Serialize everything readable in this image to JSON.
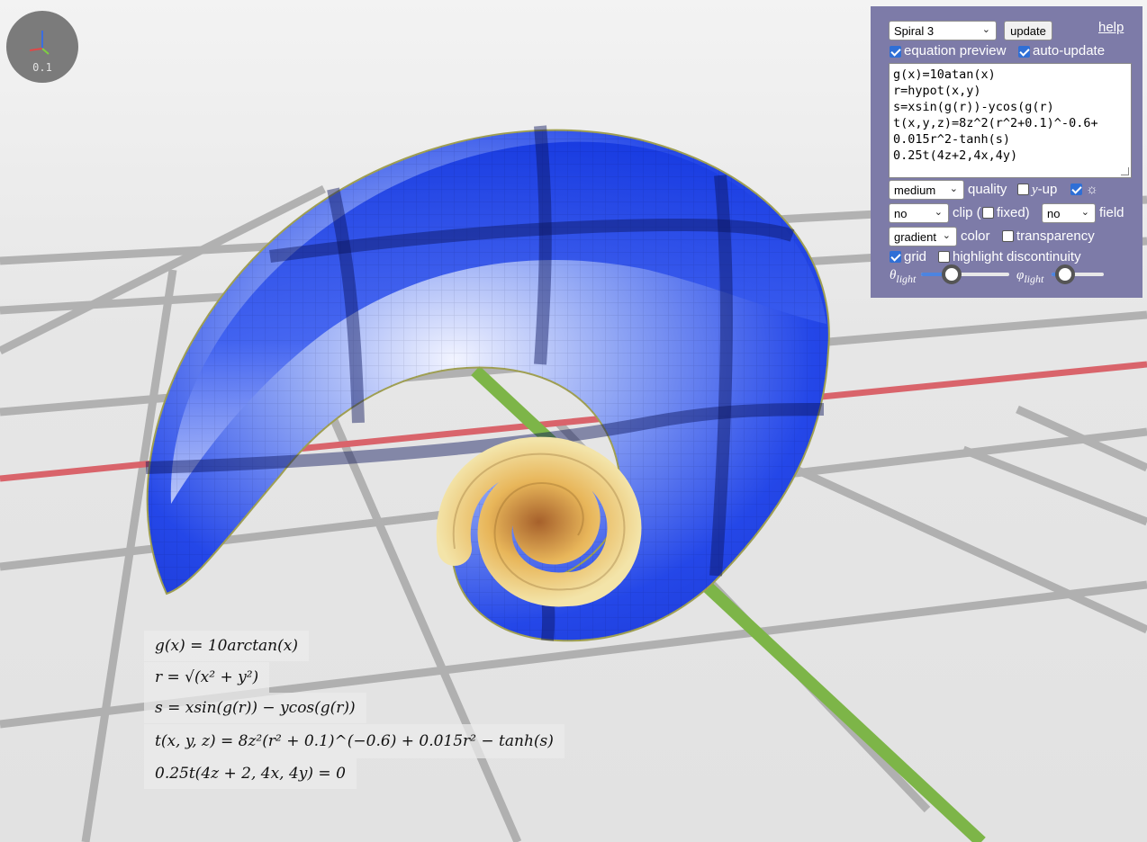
{
  "gizmo": {
    "scale_label": "0.1"
  },
  "panel": {
    "preset": {
      "selected": "Spiral 3"
    },
    "update_label": "update",
    "help_label": "help",
    "equation_preview": {
      "label": "equation preview",
      "checked": true
    },
    "auto_update": {
      "label": "auto-update",
      "checked": true
    },
    "editor_lines": [
      "g(x)=10atan(x)",
      "r=hypot(x,y)",
      "s=xsin(g(r))-ycos(g(r)",
      "t(x,y,z)=8z^2(r^2+0.1)^-0.6+",
      "0.015r^2-tanh(s)",
      "0.25t(4z+2,4x,4y)"
    ],
    "quality": {
      "selected": "medium",
      "label": "quality"
    },
    "y_up": {
      "label_var": "y",
      "label_rest": "-up",
      "checked": false
    },
    "light_toggle": {
      "symbol": "☼",
      "checked": true
    },
    "clip": {
      "selected": "no",
      "label": "clip (",
      "fixed_label": "fixed)",
      "fixed_checked": false
    },
    "field": {
      "selected": "no",
      "label": "field"
    },
    "color": {
      "selected": "gradient",
      "label": "color"
    },
    "transparency": {
      "label": "transparency",
      "checked": false
    },
    "grid": {
      "label": "grid",
      "checked": true
    },
    "highlight_discontinuity": {
      "label": "highlight discontinuity",
      "checked": false
    },
    "theta_light": {
      "symbol": "θ",
      "subscript": "light",
      "value": 0.35
    },
    "phi_light": {
      "symbol": "φ",
      "subscript": "light",
      "value": 0.25
    }
  },
  "equations": [
    "g(x) = 10arctan(x)",
    "r = √(x² + y²)",
    "s = xsin(g(r)) − ycos(g(r))",
    "t(x, y, z) = 8z²(r² + 0.1)^(−0.6) + 0.015r² − tanh(s)",
    "0.25t(4z + 2, 4x, 4y) = 0"
  ],
  "colors": {
    "panel_bg": "#7d7ba8",
    "surface_blue": "#1f47e6",
    "surface_yellow": "#e9d98a",
    "axis_x": "#d9646b",
    "axis_y": "#7db548",
    "floor_grid": "#a9a9a9"
  }
}
